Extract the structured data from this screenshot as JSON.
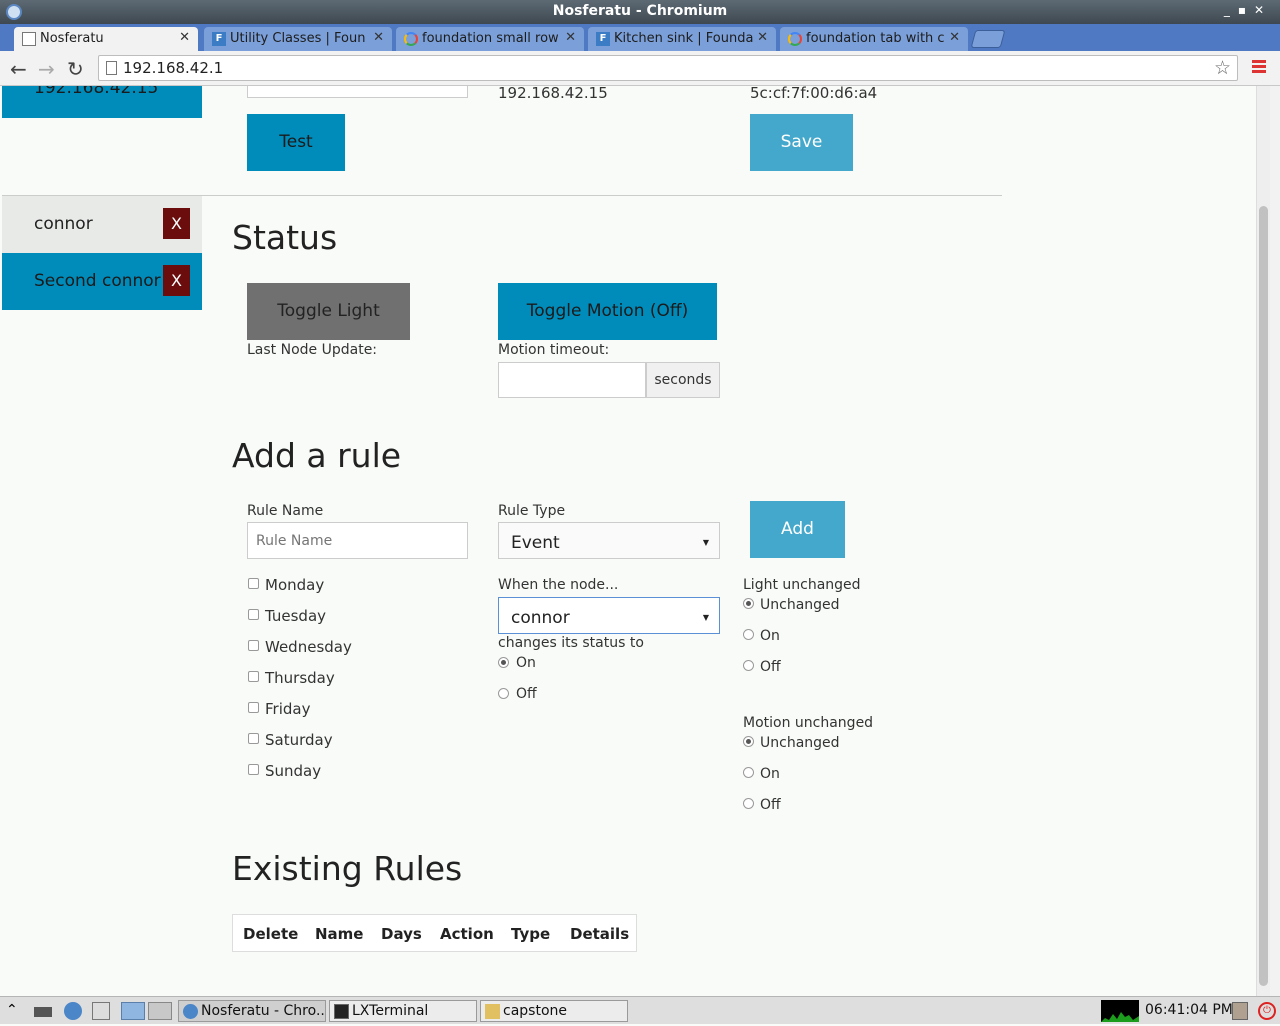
{
  "window": {
    "title": "Nosferatu - Chromium"
  },
  "tabs": [
    {
      "label": "Nosferatu",
      "icon": "page-icon"
    },
    {
      "label": "Utility Classes | Foun",
      "icon": "foundation-icon"
    },
    {
      "label": "foundation small row",
      "icon": "google-icon"
    },
    {
      "label": "Kitchen sink | Founda",
      "icon": "foundation-icon"
    },
    {
      "label": "foundation tab with c",
      "icon": "google-icon"
    }
  ],
  "toolbar": {
    "url": "192.168.42.1"
  },
  "sidebar": {
    "top_partial": "192.168.42.15",
    "items": [
      {
        "label": "connor",
        "delete": "X"
      },
      {
        "label": "Second connor",
        "delete": "X"
      }
    ]
  },
  "node_config": {
    "ip": "192.168.42.15",
    "mac": "5c:cf:7f:00:d6:a4",
    "test_label": "Test",
    "save_label": "Save"
  },
  "status": {
    "heading": "Status",
    "toggle_light": "Toggle Light",
    "toggle_motion": "Toggle Motion (Off)",
    "last_update_label": "Last Node Update:",
    "motion_timeout_label": "Motion timeout:",
    "seconds_label": "seconds"
  },
  "add_rule": {
    "heading": "Add a rule",
    "rule_name_label": "Rule Name",
    "rule_name_placeholder": "Rule Name",
    "rule_type_label": "Rule Type",
    "rule_type_value": "Event",
    "add_label": "Add",
    "days": [
      "Monday",
      "Tuesday",
      "Wednesday",
      "Thursday",
      "Friday",
      "Saturday",
      "Sunday"
    ],
    "when_label": "When the node...",
    "node_value": "connor",
    "changes_label": "changes its status to",
    "status_options": [
      "On",
      "Off"
    ],
    "light_label": "Light unchanged",
    "light_options": [
      "Unchanged",
      "On",
      "Off"
    ],
    "motion_label": "Motion unchanged",
    "motion_options": [
      "Unchanged",
      "On",
      "Off"
    ]
  },
  "existing_rules": {
    "heading": "Existing Rules",
    "columns": [
      "Delete",
      "Name",
      "Days",
      "Action",
      "Type",
      "Details"
    ]
  },
  "taskbar": {
    "windows": [
      "Nosferatu - Chro...",
      "LXTerminal",
      "capstone"
    ],
    "clock": "06:41:04 PM"
  },
  "colors": {
    "primary": "#008cba",
    "light_blue": "#43a8cb",
    "gray_button": "#6f706f",
    "delete_red": "#6b0d0d"
  }
}
